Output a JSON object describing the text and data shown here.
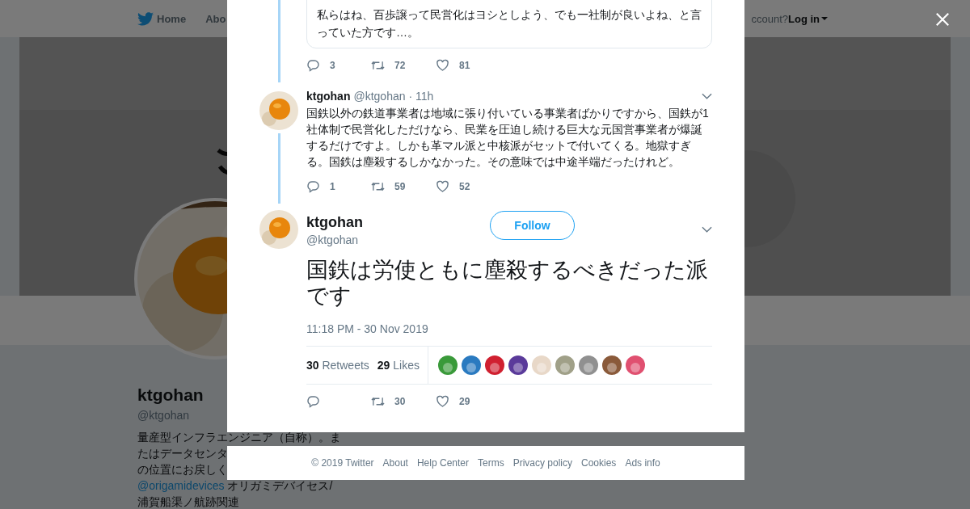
{
  "nav": {
    "items": [
      {
        "label": "Home"
      },
      {
        "label": "Abo"
      }
    ],
    "account_prompt": "ccount?",
    "login": "Log in"
  },
  "profile": {
    "name": "ktgohan",
    "handle": "@ktgohan",
    "bio": [
      {
        "text": "量産型インフラエンジニア（自称）。ま"
      },
      {
        "text": "たはデータセンタ"
      },
      {
        "text": "の位置にお戻しく"
      },
      {
        "mention": "@origamidevices",
        "text": "オリガミデバイセス/"
      },
      {
        "text": "浦賀船渠ノ航跡関連"
      }
    ]
  },
  "thread": [
    {
      "kind": "context",
      "quote": "私らはね、百歩譲って民営化はヨシとしよう、でも一社制が良いよね、と言っていた方です…。",
      "replies": "3",
      "retweets": "72",
      "likes": "81"
    },
    {
      "kind": "reply",
      "name": "ktgohan",
      "handle": "@ktgohan",
      "time": "· 11h",
      "text": "国鉄以外の鉄道事業者は地域に張り付いている事業者ばかりですから、国鉄が1社体制で民営化しただけなら、民業を圧迫し続ける巨大な元国営事業者が爆誕するだけですよ。しかも革マル派と中核派がセットで付いてくる。地獄すぎる。国鉄は塵殺するしかなかった。その意味では中途半端だったけれど。",
      "replies": "1",
      "retweets": "59",
      "likes": "52"
    }
  ],
  "focused": {
    "name": "ktgohan",
    "handle": "@ktgohan",
    "follow": "Follow",
    "text": "国鉄は労使ともに塵殺するべきだった派です",
    "timestamp": "11:18 PM - 30 Nov 2019",
    "retweets_count": "30",
    "retweets_label": "Retweets",
    "likes_count": "29",
    "likes_label": "Likes",
    "liker_avatars": [
      {
        "color": "#3a9a3a"
      },
      {
        "color": "#2a7ac0"
      },
      {
        "color": "#d02030"
      },
      {
        "color": "#5a3a9a"
      },
      {
        "color": "#e8d8c8"
      },
      {
        "color": "#a0a088"
      },
      {
        "color": "#909090"
      },
      {
        "color": "#8a5a3a"
      },
      {
        "color": "#e05070"
      }
    ],
    "retweets": "30",
    "likes": "29"
  },
  "footer": [
    "© 2019 Twitter",
    "About",
    "Help Center",
    "Terms",
    "Privacy policy",
    "Cookies",
    "Ads info"
  ]
}
